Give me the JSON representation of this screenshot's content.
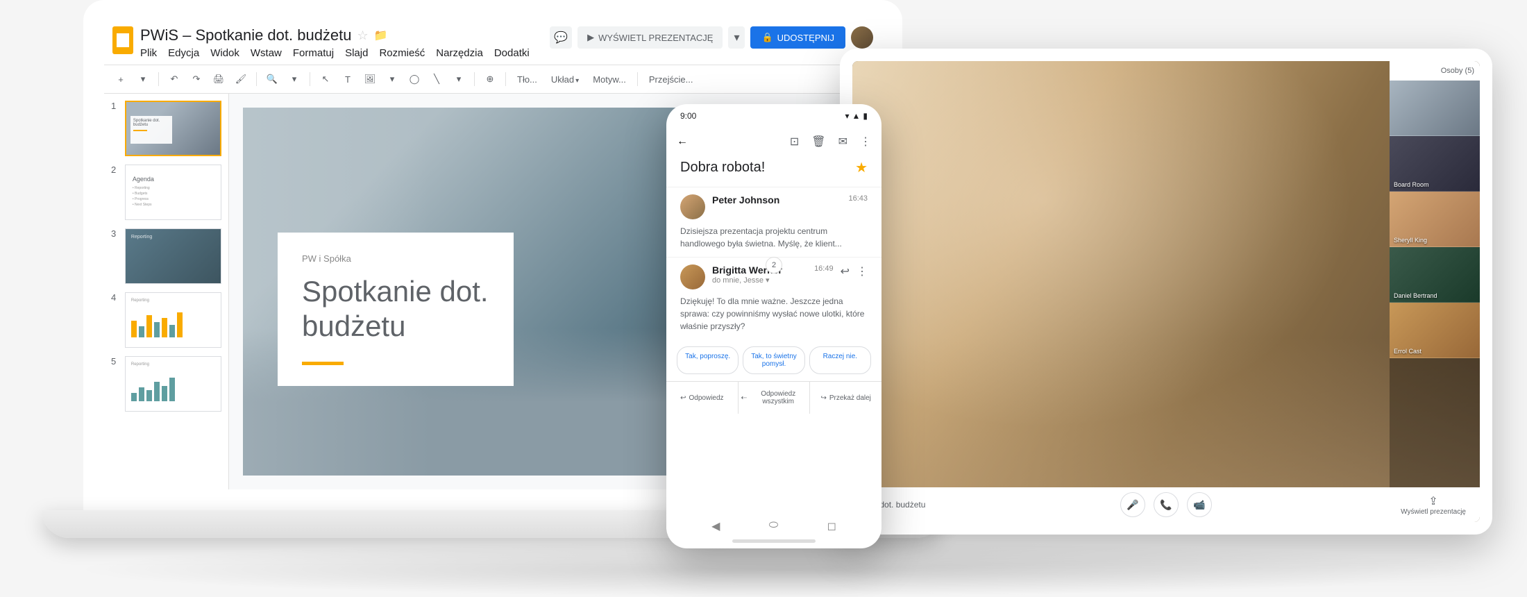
{
  "slides": {
    "doc_title": "PWiS – Spotkanie dot. budżetu",
    "menu": {
      "file": "Plik",
      "edit": "Edycja",
      "view": "Widok",
      "insert": "Wstaw",
      "format": "Formatuj",
      "slide": "Slajd",
      "arrange": "Rozmieść",
      "tools": "Narzędzia",
      "addons": "Dodatki"
    },
    "present_label": "WYŚWIETL PREZENTACJĘ",
    "share_label": "UDOSTĘPNIJ",
    "toolbar": {
      "background": "Tło...",
      "layout": "Układ",
      "theme": "Motyw...",
      "transition": "Przejście..."
    },
    "thumbs": [
      {
        "num": "1",
        "title": "Spotkanie dot. budżetu"
      },
      {
        "num": "2",
        "title": "Agenda"
      },
      {
        "num": "3",
        "title": "Reporting"
      },
      {
        "num": "4",
        "title": "Reporting"
      },
      {
        "num": "5",
        "title": "Reporting"
      }
    ],
    "main_slide": {
      "subtitle": "PW i Spółka",
      "title": "Spotkanie dot. budżetu"
    }
  },
  "email": {
    "time": "9:00",
    "subject": "Dobra robota!",
    "thread_count": "2",
    "messages": [
      {
        "sender": "Peter Johnson",
        "time": "16:43",
        "body": "Dzisiejsza prezentacja projektu centrum handlowego była świetna. Myślę, że klient..."
      },
      {
        "sender": "Brigitta Werner",
        "to": "do mnie, Jesse",
        "time": "16:49",
        "body": "Dziękuję! To dla mnie ważne. Jeszcze jedna sprawa: czy powinniśmy wysłać nowe ulotki, które właśnie przyszły?"
      }
    ],
    "smart_replies": [
      "Tak, poproszę.",
      "Tak, to świetny pomysł.",
      "Raczej nie."
    ],
    "actions": {
      "reply": "Odpowiedz",
      "reply_all": "Odpowiedz wszystkim",
      "forward": "Przekaż dalej"
    }
  },
  "meet": {
    "participants_header": "Osoby (5)",
    "participants": [
      "Board Room",
      "Sheryll King",
      "Daniel Bertrand",
      "Errol Cast"
    ],
    "footer_title": "nie dot. budżetu",
    "present_action": "Wyświetl prezentację"
  }
}
